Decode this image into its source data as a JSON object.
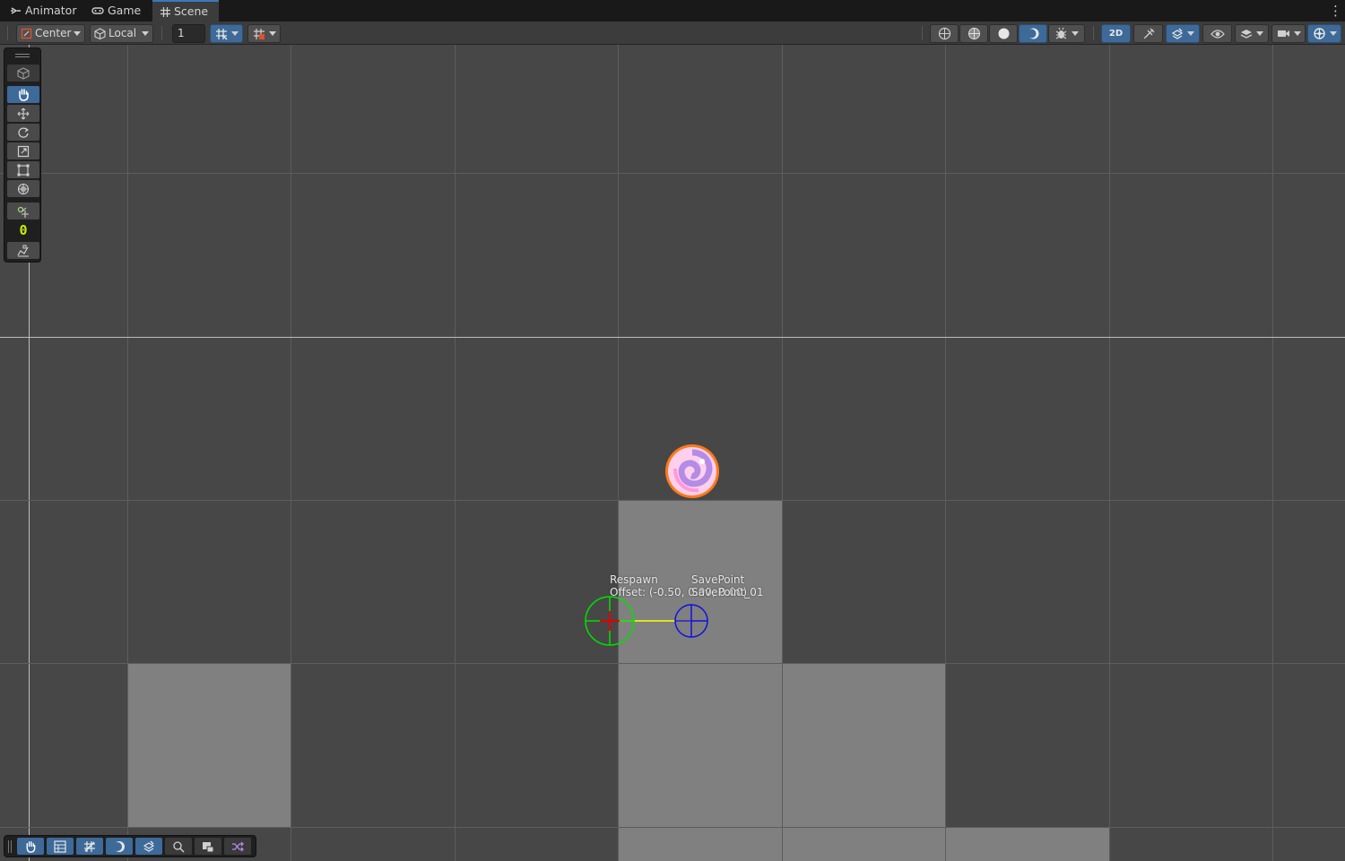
{
  "tabs": [
    {
      "label": "Animator",
      "icon": "animator-icon",
      "active": false
    },
    {
      "label": "Game",
      "icon": "gamepad-icon",
      "active": false
    },
    {
      "label": "Scene",
      "icon": "grid-hash-icon",
      "active": true
    }
  ],
  "toolbar": {
    "pivot_mode": "Center",
    "pivot_rotation": "Local",
    "grid_snap_value": "1",
    "mode_2d_label": "2D",
    "icons": [
      "grid-snap-icon",
      "snap-increment-icon",
      "wireframe-shading-icon",
      "shaded-wireframe-icon",
      "shaded-icon",
      "unlit-icon",
      "debug-bug-icon",
      "lighting-off-icon",
      "effects-layers-icon",
      "visibility-eye-icon",
      "layers-icon",
      "camera-icon",
      "gizmos-icon"
    ]
  },
  "tools": {
    "counter": "0",
    "items": [
      "view-cube-icon",
      "hand-tool-icon",
      "move-tool-icon",
      "rotate-tool-icon",
      "scale-tool-icon",
      "rect-tool-icon",
      "transform-tool-icon",
      "custom-tool-icon",
      "tile-brush-icon"
    ]
  },
  "scene": {
    "respawn_label": "Respawn",
    "respawn_offset": "Offset: (-0.50, 0.00, 0.00)",
    "savepoint_label": "SavePoint",
    "savepoint_name": "SavePoint_01",
    "colors": {
      "background": "#474747",
      "tile": "#808080",
      "respawn_circle": "#00e000",
      "respawn_cross": "#e00000",
      "savepoint_circle": "#1010e0",
      "link_line": "#ffff00",
      "sprite_outline": "#ff7a1a",
      "sprite_fill": "#ffb6e6",
      "sprite_swirl": "#b48ce6"
    }
  },
  "bottom_overlay": {
    "icons": [
      "hand-tool-icon",
      "tile-palette-icon",
      "grid-paint-icon",
      "lighting-icon",
      "layers-stack-icon",
      "zoom-magnifier-icon",
      "camera-preview-icon",
      "shuffle-random-icon"
    ]
  }
}
